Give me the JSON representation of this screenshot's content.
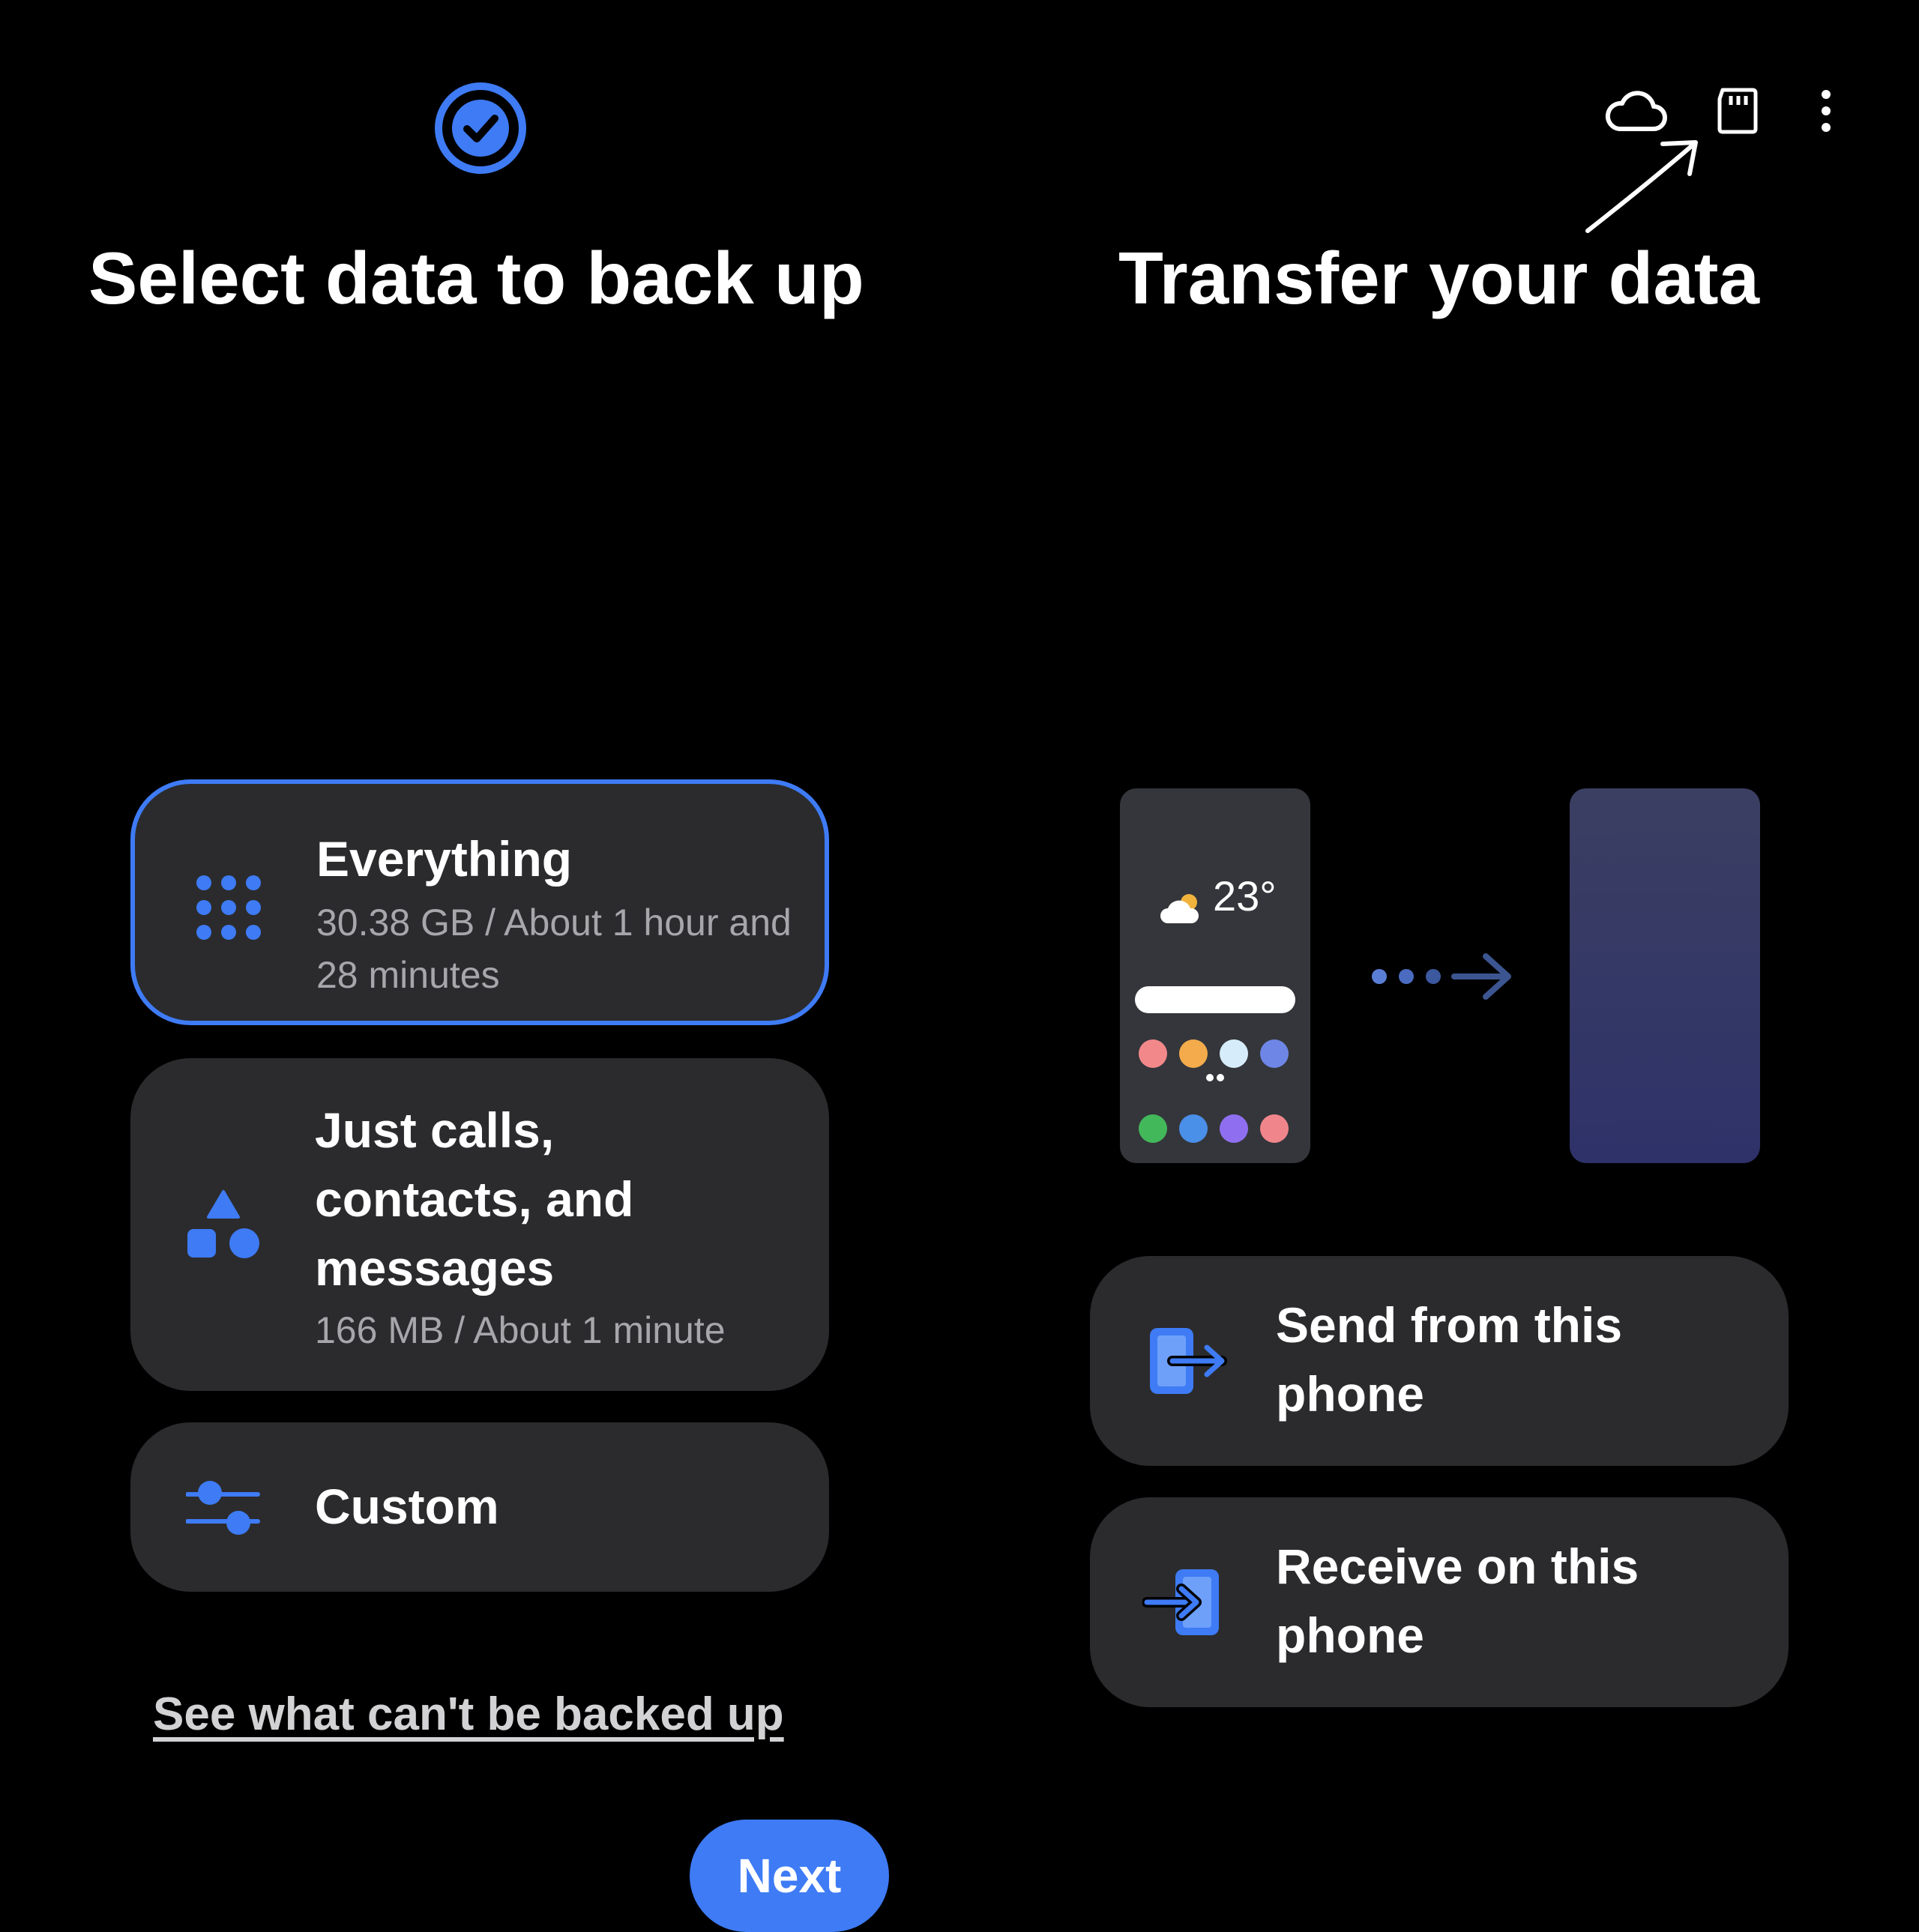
{
  "toolbar": {
    "icons": [
      "cloud-icon",
      "sd-card-icon",
      "more-options-icon"
    ]
  },
  "status": {
    "icon": "check-circle-icon"
  },
  "backup": {
    "title": "Select data to back up",
    "options": [
      {
        "label": "Everything",
        "detail": "30.38 GB / About 1 hour and 28 minutes",
        "icon": "grid-dots-icon",
        "selected": true
      },
      {
        "label": "Just calls, contacts, and messages",
        "detail": "166 MB / About 1 minute",
        "icon": "shapes-icon",
        "selected": false
      },
      {
        "label": "Custom",
        "icon": "sliders-icon",
        "selected": false
      }
    ],
    "link": "See what can't be backed up",
    "next_label": "Next"
  },
  "transfer": {
    "title": "Transfer your data",
    "illustration": {
      "temperature": "23°"
    },
    "options": [
      {
        "label": "Send from this phone",
        "icon": "send-phone-icon"
      },
      {
        "label": "Receive on this phone",
        "icon": "receive-phone-icon"
      }
    ]
  },
  "colors": {
    "accent": "#3e7bf5",
    "card": "#2b2b2d",
    "background": "#000000"
  }
}
